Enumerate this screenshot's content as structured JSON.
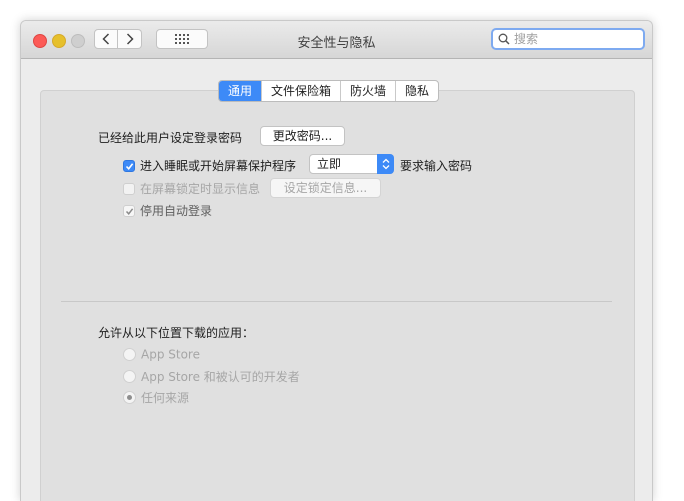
{
  "window": {
    "title": "安全性与隐私",
    "search": {
      "placeholder": "搜索",
      "value": ""
    }
  },
  "tabs": [
    {
      "label": "通用",
      "active": true
    },
    {
      "label": "文件保险箱",
      "active": false
    },
    {
      "label": "防火墙",
      "active": false
    },
    {
      "label": "隐私",
      "active": false
    }
  ],
  "general": {
    "password_set_label": "已经给此用户设定登录密码",
    "change_password_button": "更改密码...",
    "require_password": {
      "checked": true,
      "label": "进入睡眠或开始屏幕保护程序",
      "delay_value": "立即",
      "suffix": "要求输入密码"
    },
    "show_message": {
      "checked": false,
      "label": "在屏幕锁定时显示信息",
      "button": "设定锁定信息..."
    },
    "disable_auto_login": {
      "checked": true,
      "label": "停用自动登录"
    }
  },
  "downloads": {
    "heading": "允许从以下位置下载的应用：",
    "options": [
      {
        "label": "App Store",
        "selected": false
      },
      {
        "label": "App Store 和被认可的开发者",
        "selected": false
      },
      {
        "label": "任何来源",
        "selected": true
      }
    ]
  },
  "icons": {
    "back": "chevron-left-icon",
    "forward": "chevron-right-icon",
    "grid": "grid-icon",
    "search": "magnifier-icon",
    "select": "up-down-chevron-icon",
    "checkmark": "checkmark-icon"
  },
  "colors": {
    "accent": "#3d8af7",
    "close": "#fc5b57",
    "minimize": "#e6c02c",
    "zoom_disabled": "#cfcfcf"
  }
}
